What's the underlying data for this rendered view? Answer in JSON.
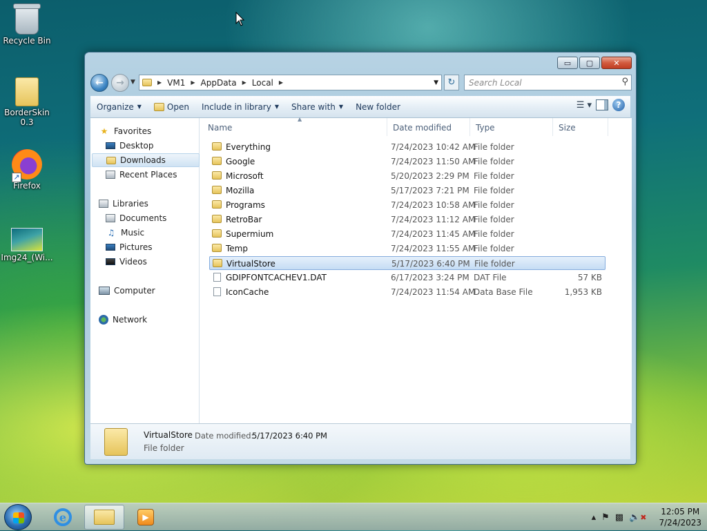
{
  "desktop": {
    "icons": [
      {
        "label": "Recycle Bin"
      },
      {
        "label": "BorderSkin 0.3"
      },
      {
        "label": "Firefox"
      },
      {
        "label": "Img24_(Wi..."
      }
    ]
  },
  "window": {
    "caption": {
      "minimize": "▭",
      "maximize": "▢",
      "close": "✕"
    },
    "address": {
      "crumbs": [
        "VM1",
        "AppData",
        "Local"
      ]
    },
    "search": {
      "placeholder": "Search Local"
    },
    "toolbar": {
      "organize": "Organize",
      "open": "Open",
      "include_in_library": "Include in library",
      "share_with": "Share with",
      "new_folder": "New folder"
    },
    "nav": {
      "favorites": "Favorites",
      "desktop": "Desktop",
      "downloads": "Downloads",
      "recent_places": "Recent Places",
      "libraries": "Libraries",
      "documents": "Documents",
      "music": "Music",
      "pictures": "Pictures",
      "videos": "Videos",
      "computer": "Computer",
      "network": "Network"
    },
    "columns": {
      "name": "Name",
      "date": "Date modified",
      "type": "Type",
      "size": "Size"
    },
    "files": [
      {
        "name": "Everything",
        "date": "7/24/2023 10:42 AM",
        "type": "File folder",
        "size": ""
      },
      {
        "name": "Google",
        "date": "7/24/2023 11:50 AM",
        "type": "File folder",
        "size": ""
      },
      {
        "name": "Microsoft",
        "date": "5/20/2023 2:29 PM",
        "type": "File folder",
        "size": ""
      },
      {
        "name": "Mozilla",
        "date": "5/17/2023 7:21 PM",
        "type": "File folder",
        "size": ""
      },
      {
        "name": "Programs",
        "date": "7/24/2023 10:58 AM",
        "type": "File folder",
        "size": ""
      },
      {
        "name": "RetroBar",
        "date": "7/24/2023 11:12 AM",
        "type": "File folder",
        "size": ""
      },
      {
        "name": "Supermium",
        "date": "7/24/2023 11:45 AM",
        "type": "File folder",
        "size": ""
      },
      {
        "name": "Temp",
        "date": "7/24/2023 11:55 AM",
        "type": "File folder",
        "size": ""
      },
      {
        "name": "VirtualStore",
        "date": "5/17/2023 6:40 PM",
        "type": "File folder",
        "size": ""
      },
      {
        "name": "GDIPFONTCACHEV1.DAT",
        "date": "6/17/2023 3:24 PM",
        "type": "DAT File",
        "size": "57 KB"
      },
      {
        "name": "IconCache",
        "date": "7/24/2023 11:54 AM",
        "type": "Data Base File",
        "size": "1,953 KB"
      }
    ],
    "selected_index": 8,
    "details": {
      "name": "VirtualStore",
      "date_label": "Date modified:",
      "date_value": "5/17/2023 6:40 PM",
      "type": "File folder"
    }
  },
  "taskbar": {
    "clock_time": "12:05 PM",
    "clock_date": "7/24/2023"
  }
}
